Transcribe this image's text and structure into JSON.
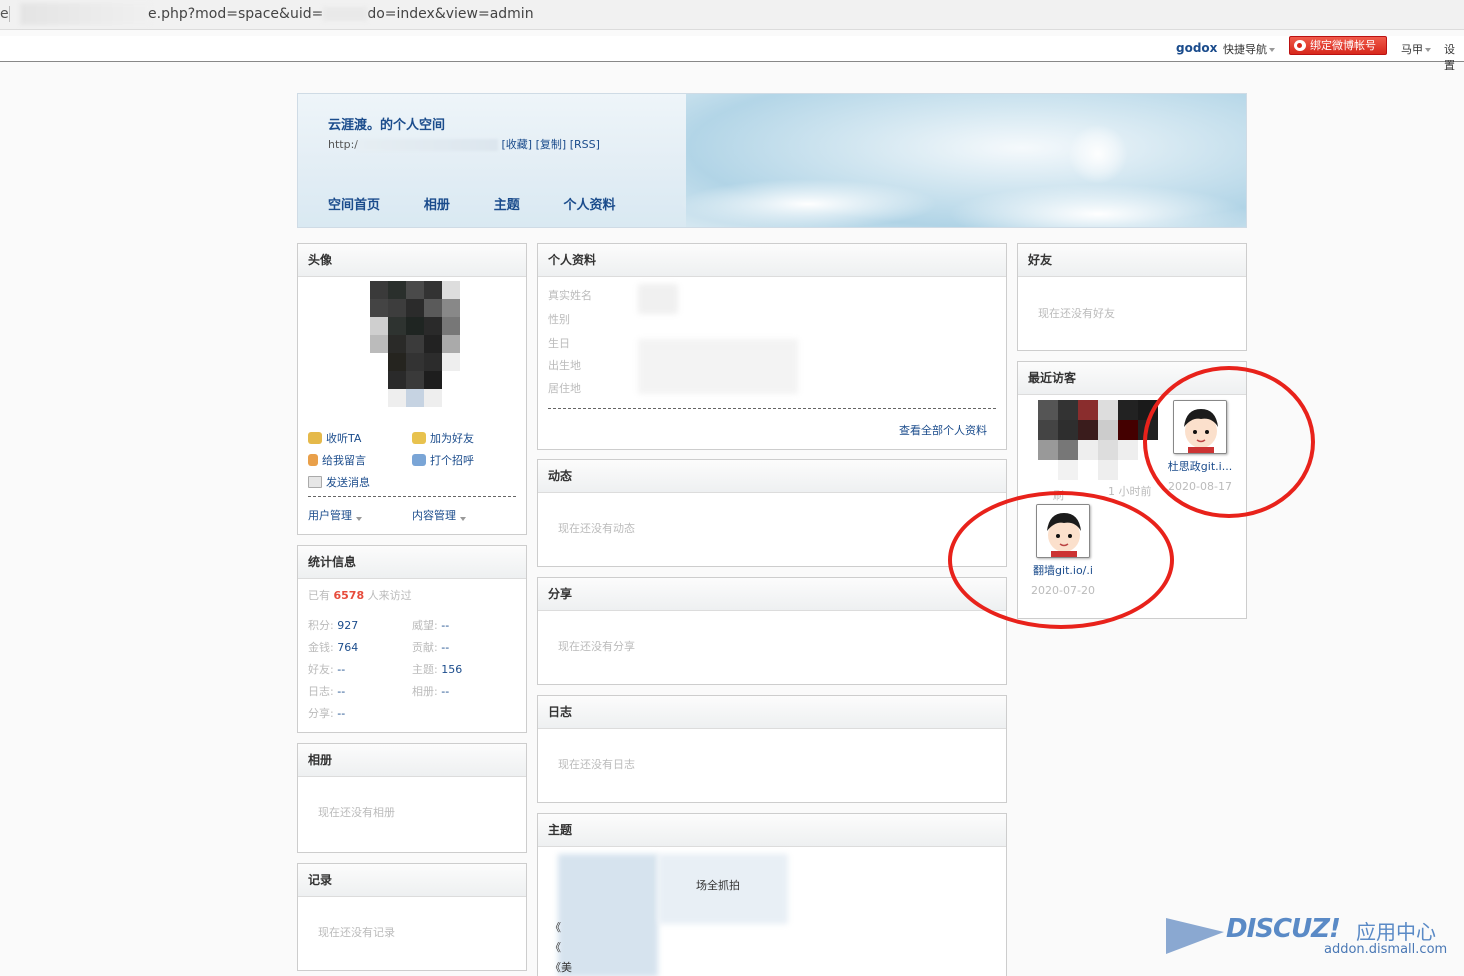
{
  "browser": {
    "url": "e.php?mod=space&uid=",
    "url_tail": "do=index&view=admin",
    "edge_char": "e"
  },
  "topbar": {
    "username": "godox",
    "quick_nav": "快捷导航",
    "weibo_button": "绑定微博帐号",
    "user_menu": "马甲",
    "settings": "设置"
  },
  "header": {
    "title": "云涯渡。的个人空间",
    "url_prefix": "http:/",
    "links": [
      "[收藏]",
      "[复制]",
      "[RSS]"
    ],
    "nav": [
      "空间首页",
      "相册",
      "主题",
      "个人资料"
    ]
  },
  "avatar_panel": {
    "title": "头像",
    "actions": [
      "收听TA",
      "加为好友",
      "给我留言",
      "打个招呼",
      "发送消息"
    ],
    "menus": [
      "用户管理",
      "内容管理"
    ]
  },
  "stats_panel": {
    "title": "统计信息",
    "visits_prefix": "已有",
    "visits_count": "6578",
    "visits_suffix": "人来访过",
    "items": [
      {
        "k": "积分:",
        "v": "927"
      },
      {
        "k": "威望:",
        "v": "--"
      },
      {
        "k": "金钱:",
        "v": "764"
      },
      {
        "k": "贡献:",
        "v": "--"
      },
      {
        "k": "好友:",
        "v": "--"
      },
      {
        "k": "主题:",
        "v": "156"
      },
      {
        "k": "日志:",
        "v": "--"
      },
      {
        "k": "相册:",
        "v": "--"
      },
      {
        "k": "分享:",
        "v": "--"
      }
    ]
  },
  "album_panel": {
    "title": "相册",
    "empty": "现在还没有相册"
  },
  "record_panel": {
    "title": "记录",
    "empty": "现在还没有记录"
  },
  "profile_panel": {
    "title": "个人资料",
    "fields": [
      "真实姓名",
      "性别",
      "生日",
      "出生地",
      "居住地"
    ],
    "view_all": "查看全部个人资料"
  },
  "feed_panel": {
    "title": "动态",
    "empty": "现在还没有动态"
  },
  "share_panel": {
    "title": "分享",
    "empty": "现在还没有分享"
  },
  "blog_panel": {
    "title": "日志",
    "empty": "现在还没有日志"
  },
  "thread_panel": {
    "title": "主题",
    "snippets": [
      "《",
      "《",
      "《美"
    ],
    "partial": "场全抓拍"
  },
  "friends_panel": {
    "title": "好友",
    "empty": "现在还没有好友"
  },
  "visitors_panel": {
    "title": "最近访客",
    "visitors": [
      {
        "name": "刷",
        "date": "1 小时前"
      },
      {
        "name": "杜思政git.i...",
        "date": "2020-08-17"
      },
      {
        "name": "翻墙git.io/.i",
        "date": "2020-07-20"
      }
    ]
  },
  "watermark": {
    "brand": "DISCUZ!",
    "cn": "应用中心",
    "site": "addon.dismall.com"
  },
  "colors": {
    "link": "#1b4c8c",
    "highlight": "#e8221b",
    "accent_count": "#e74c3c"
  }
}
